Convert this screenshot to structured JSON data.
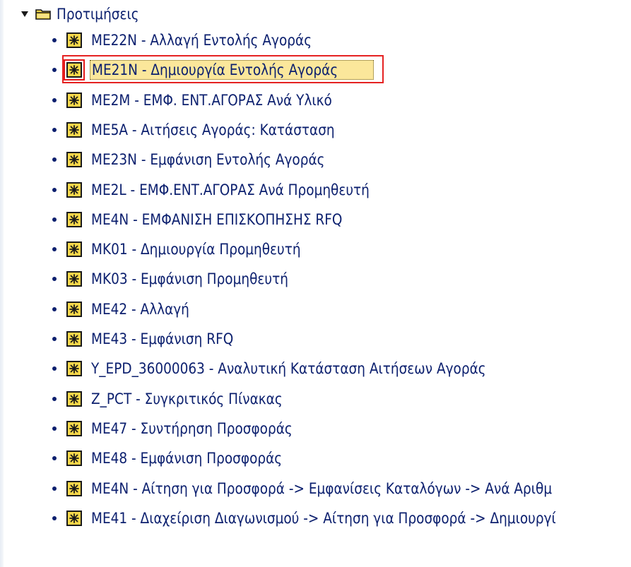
{
  "tree": {
    "folder": {
      "label": "Προτιμήσεις",
      "icon": "folder-open-icon",
      "expanded": true
    },
    "items": [
      {
        "label": "ME22N - Αλλαγή Εντολής Αγοράς",
        "icon": "transaction-icon"
      },
      {
        "label": "ME21N - Δημιουργία Εντολής Αγοράς",
        "icon": "transaction-icon",
        "selected": true
      },
      {
        "label": "ME2M - ΕΜΦ. ΕΝΤ.ΑΓΟΡΑΣ Ανά Υλικό",
        "icon": "transaction-icon"
      },
      {
        "label": "ME5A - Αιτήσεις Αγοράς: Κατάσταση",
        "icon": "transaction-icon"
      },
      {
        "label": "ME23N - Εμφάνιση Εντολής Αγοράς",
        "icon": "transaction-icon"
      },
      {
        "label": "ME2L - ΕΜΦ.ΕΝΤ.ΑΓΟΡΑΣ Ανά Προμηθευτή",
        "icon": "transaction-icon"
      },
      {
        "label": "ME4N - ΕΜΦΑΝΙΣΗ ΕΠΙΣΚΟΠΗΣΗΣ RFQ",
        "icon": "transaction-icon"
      },
      {
        "label": "MK01 - Δημιουργία Προμηθευτή",
        "icon": "transaction-icon"
      },
      {
        "label": "MK03 - Εμφάνιση Προμηθευτή",
        "icon": "transaction-icon"
      },
      {
        "label": "ME42 - Αλλαγή",
        "icon": "transaction-icon"
      },
      {
        "label": "ME43 - Εμφάνιση RFQ",
        "icon": "transaction-icon"
      },
      {
        "label": "Y_EPD_36000063 - Αναλυτική Κατάσταση Αιτήσεων Αγοράς",
        "icon": "transaction-icon"
      },
      {
        "label": "Z_PCT - Συγκριτικός Πίνακας",
        "icon": "transaction-icon"
      },
      {
        "label": "ME47 - Συντήρηση Προσφοράς",
        "icon": "transaction-icon"
      },
      {
        "label": "ME48 - Εμφάνιση Προσφοράς",
        "icon": "transaction-icon"
      },
      {
        "label": "ME4N - Αίτηση για Προσφορά -> Εμφανίσεις Καταλόγων -> Ανά Αριθμ",
        "icon": "transaction-icon"
      },
      {
        "label": "ME41 - Διαχείριση Διαγωνισμού -> Αίτηση για Προσφορά -> Δημιουργί",
        "icon": "transaction-icon"
      }
    ]
  },
  "colors": {
    "link_text": "#0b1f6e",
    "icon_fill": "#f6d74a",
    "selection_border": "#e52222",
    "selection_fill": "#fbe79b"
  }
}
